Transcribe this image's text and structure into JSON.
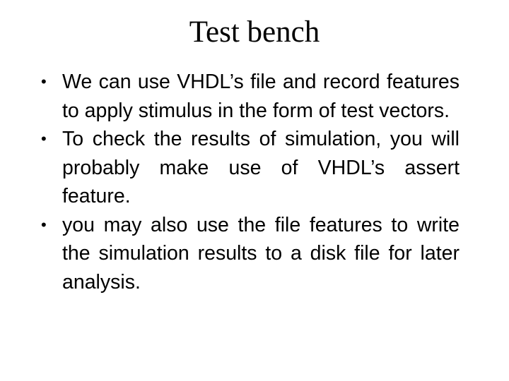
{
  "slide": {
    "title": "Test bench",
    "bullets": [
      {
        "marker": "•",
        "text": "We can use VHDL’s file and record features to apply stimulus in the form of test vectors."
      },
      {
        "marker": "•",
        "text": "To check the results of simulation, you will probably make use of VHDL’s assert feature."
      },
      {
        "marker": "•",
        "text": "you may also use the file features to write the simulation results to a disk file for later analysis."
      }
    ]
  }
}
